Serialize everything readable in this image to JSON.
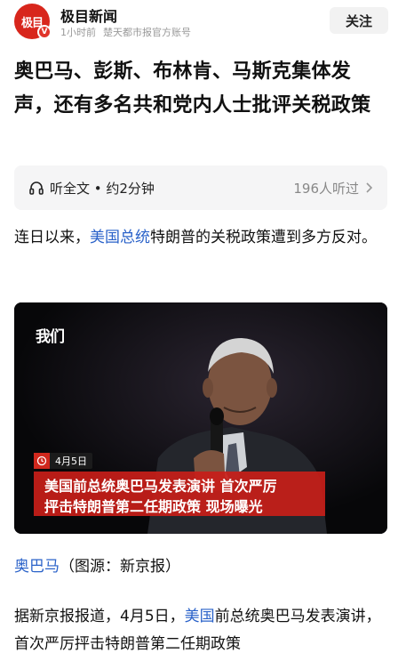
{
  "header": {
    "avatar_text": "极目",
    "badge_text": "V",
    "account_name": "极目新闻",
    "time": "1小时前",
    "source": "楚天都市报官方账号",
    "follow_label": "关注"
  },
  "article": {
    "title": "奥巴马、彭斯、布林肯、马斯克集体发声，还有多名共和党内人士批评关税政策",
    "listen": {
      "label": "听全文 • 约2分钟",
      "count": "196人听过"
    },
    "para1": {
      "before": "连日以来，",
      "link": "美国总统",
      "after": "特朗普的关税政策遭到多方反对。"
    },
    "video": {
      "logo": "我们",
      "date": "4月5日",
      "caption_line1": "美国前总统奥巴马发表演讲 首次严厉",
      "caption_line2": "抨击特朗普第二任期政策 现场曝光"
    },
    "image_credit": {
      "link": "奥巴马",
      "text": "（图源：新京报）"
    },
    "para2": {
      "before": "据新京报报道，4月5日，",
      "link": "美国",
      "after": "前总统奥巴马发表演讲，首次严厉抨击特朗普第二任期政策"
    }
  },
  "colors": {
    "brand_red": "#d8261c",
    "link_blue": "#2a62c9",
    "caption_red": "#c81e19"
  }
}
